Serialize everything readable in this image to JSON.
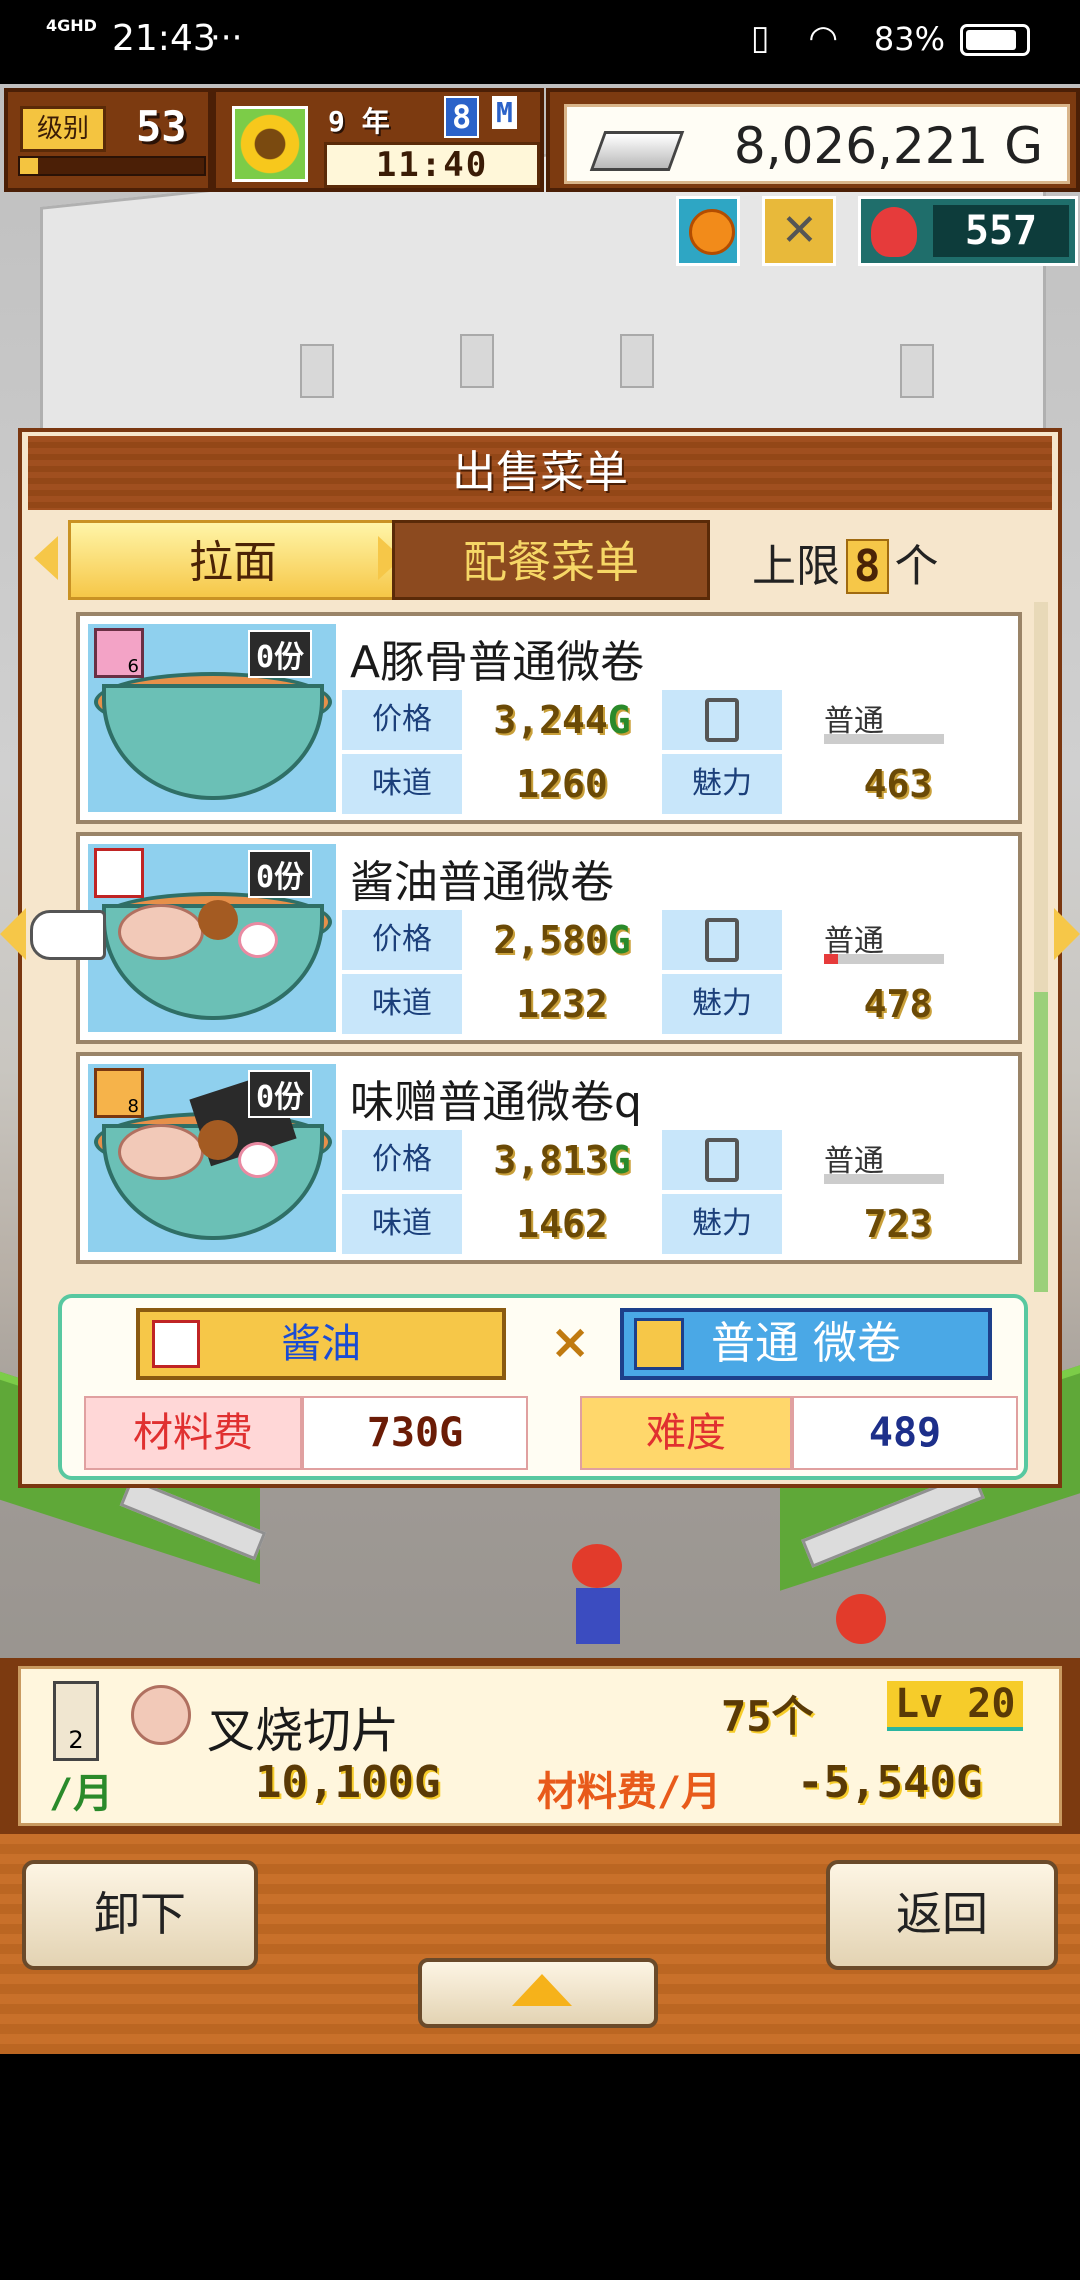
{
  "status_bar": {
    "network": "4GHD",
    "time": "21:43",
    "dots": "···",
    "battery": "83%"
  },
  "hud": {
    "level_label": "级别",
    "level": "53",
    "level_progress": 0.1,
    "year_text": "9 年",
    "month": "8",
    "month_tag": "M",
    "clock": "11:40",
    "money": "8,026,221 G",
    "points": "557"
  },
  "panel": {
    "title": "出售菜单",
    "tab_ramen": "拉面",
    "tab_combo": "配餐菜单",
    "limit_prefix": "上限",
    "limit_value": "8",
    "limit_suffix": "个",
    "label_price": "价格",
    "label_taste": "味道",
    "label_charm": "魅力",
    "dishes": [
      {
        "share": "0份",
        "stamp": "6",
        "name": "A豚骨普通微卷",
        "price": "3,244",
        "unit": "G",
        "speed": "普通",
        "speed_level": 0,
        "taste": "1260",
        "charm": "463"
      },
      {
        "share": "0份",
        "stamp": "",
        "name": "酱油普通微卷",
        "price": "2,580",
        "unit": "G",
        "speed": "普通",
        "speed_level": 0.12,
        "taste": "1232",
        "charm": "478"
      },
      {
        "share": "0份",
        "stamp": "8",
        "name": "味赠普通微卷q",
        "price": "3,813",
        "unit": "G",
        "speed": "普通",
        "speed_level": 0,
        "taste": "1462",
        "charm": "723"
      }
    ],
    "combo": {
      "soup": "酱油",
      "times": "×",
      "noodle": "普通 微卷",
      "cost_label": "材料费",
      "cost_value": "730G",
      "difficulty_label": "难度",
      "difficulty_value": "489"
    }
  },
  "info": {
    "floor": "2",
    "name": "叉烧切片",
    "qty": "75个",
    "lv": "Lv 20",
    "per_month": "/月",
    "income": "10,100G",
    "cost_tag": "材料费/月",
    "cost": "-5,540G"
  },
  "buttons": {
    "unload": "卸下",
    "back": "返回"
  }
}
